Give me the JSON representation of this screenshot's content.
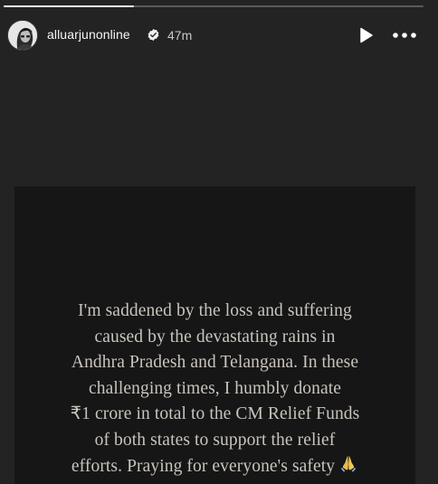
{
  "story": {
    "progress_fraction": 0.31,
    "username": "alluarjunonline",
    "verified": true,
    "time_ago": "47m",
    "icons": {
      "avatar": "profile-avatar",
      "verified": "verified-badge-icon",
      "play": "play-icon",
      "more": "more-options-icon",
      "pray": "folded-hands-emoji"
    },
    "message_lines": [
      "I'm saddened by the loss and suffering",
      "caused by the devastating rains in",
      "Andhra Pradesh and Telangana. In these",
      "challenging times, I humbly donate",
      "₹1 crore in total to the CM Relief Funds",
      "of both states to support the relief",
      "efforts. Praying for everyone's safety"
    ]
  }
}
